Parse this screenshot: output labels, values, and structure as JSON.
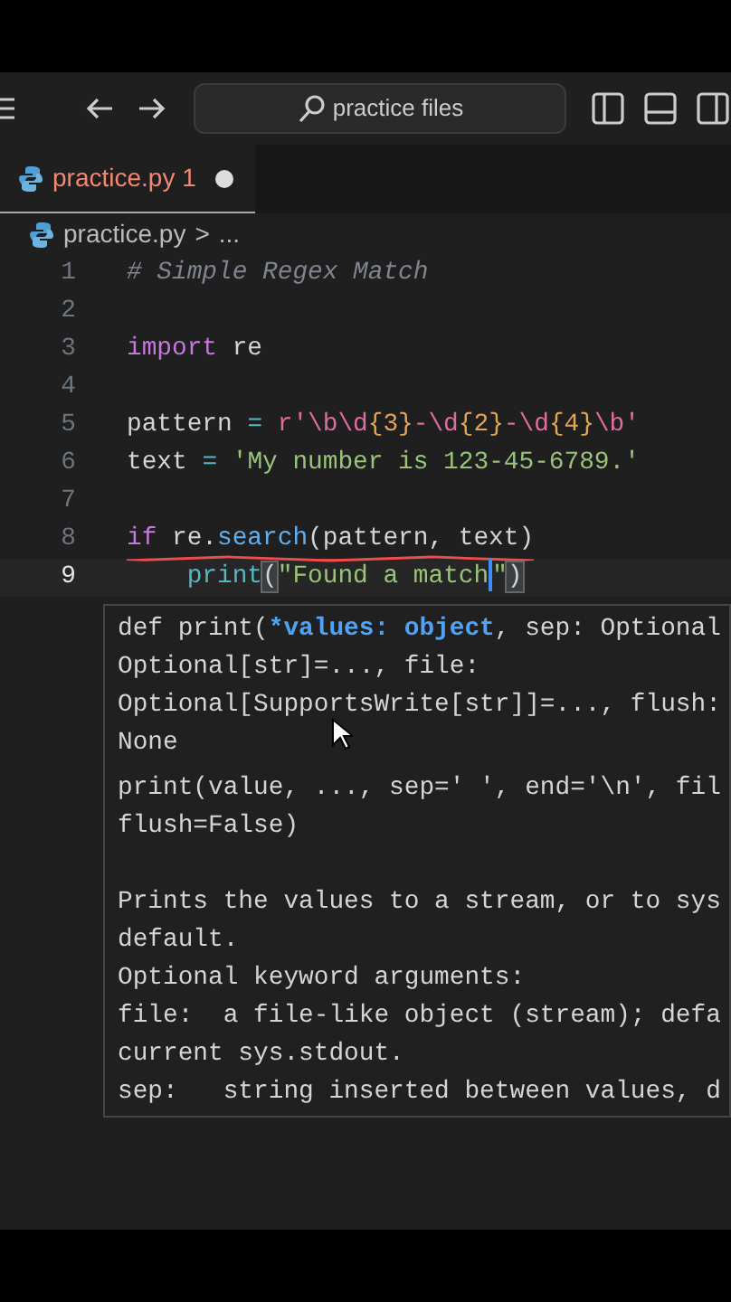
{
  "title_bar": {
    "search": "practice files"
  },
  "tabs": [
    {
      "label": "practice.py",
      "problems": "1",
      "modified": true,
      "selected": true
    }
  ],
  "breadcrumb": {
    "file": "practice.py",
    "separator": ">",
    "rest": "..."
  },
  "editor": {
    "lines": [
      {
        "number": "1",
        "current": false,
        "error": false,
        "tokens": [
          {
            "kind": "comment",
            "text": "# Simple Regex Match"
          }
        ]
      },
      {
        "number": "2",
        "current": false,
        "error": false
      },
      {
        "number": "3",
        "current": false,
        "error": false,
        "tokens": [
          {
            "kind": "keyword",
            "text": "import"
          },
          {
            "kind": "plain",
            "text": " re"
          }
        ]
      },
      {
        "number": "4",
        "current": false,
        "error": false
      },
      {
        "number": "5",
        "current": false,
        "error": false,
        "tokens": [
          {
            "kind": "plain",
            "text": "pattern "
          },
          {
            "kind": "op",
            "text": "= "
          },
          {
            "kind": "regex",
            "text": "r'\\b\\d"
          },
          {
            "kind": "quant",
            "text": "{3}"
          },
          {
            "kind": "regex",
            "text": "-\\d"
          },
          {
            "kind": "quant",
            "text": "{2}"
          },
          {
            "kind": "regex",
            "text": "-\\d"
          },
          {
            "kind": "quant",
            "text": "{4}"
          },
          {
            "kind": "regex",
            "text": "\\b'"
          }
        ]
      },
      {
        "number": "6",
        "current": false,
        "error": false,
        "tokens": [
          {
            "kind": "plain",
            "text": "text "
          },
          {
            "kind": "op",
            "text": "= "
          },
          {
            "kind": "string",
            "text": "'My number is 123-45-6789.'"
          }
        ]
      },
      {
        "number": "7",
        "current": false,
        "error": false
      },
      {
        "number": "8",
        "current": false,
        "error": true,
        "tokens": [
          {
            "kind": "keyword",
            "text": "if"
          },
          {
            "kind": "plain",
            "text": " re."
          },
          {
            "kind": "method",
            "text": "search"
          },
          {
            "kind": "paren",
            "text": "(pattern, text)"
          }
        ]
      },
      {
        "number": "9",
        "current": true,
        "error": false,
        "tokens": [
          {
            "kind": "func",
            "text": "    print"
          },
          {
            "kind": "bracket",
            "text": "("
          },
          {
            "kind": "string",
            "text": "\"Found a match"
          },
          {
            "kind": "caret"
          },
          {
            "kind": "string",
            "text": "\""
          },
          {
            "kind": "bracket",
            "text": ")"
          }
        ]
      }
    ]
  },
  "hover": {
    "signature": [
      [
        {
          "kind": "plain",
          "text": "def print("
        },
        {
          "kind": "param",
          "text": "*values: object"
        },
        {
          "kind": "plain",
          "text": ", sep: Optional"
        }
      ],
      [
        {
          "kind": "plain",
          "text": "Optional[str]=..., file:"
        }
      ],
      [
        {
          "kind": "plain",
          "text": "Optional[SupportsWrite[str]]=..., flush:"
        }
      ],
      [
        {
          "kind": "plain",
          "text": "None"
        }
      ]
    ],
    "doc": [
      [
        "print(value, ..., sep=' ', end='\\n', fil",
        "flush=False)"
      ],
      [
        "Prints the values to a stream, or to sys",
        "default.",
        "Optional keyword arguments:",
        "file:  a file-like object (stream); defa",
        "current sys.stdout.",
        "sep:   string inserted between values, d"
      ]
    ]
  }
}
